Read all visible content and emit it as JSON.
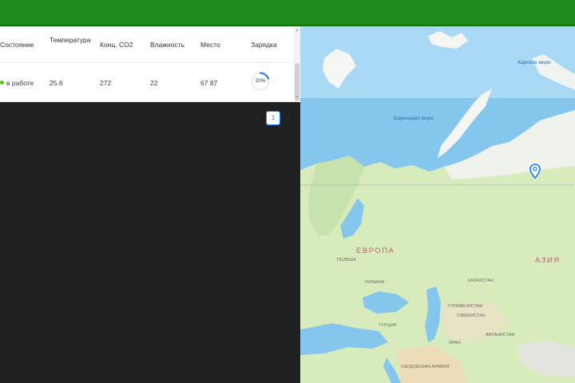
{
  "table": {
    "columns": [
      "Состояние",
      "Температура",
      "Конц. CO2",
      "Влажность",
      "Место",
      "Зарядка"
    ],
    "rows": [
      {
        "status": "в работе",
        "temperature": "25.6",
        "co2": "272",
        "humidity": "22",
        "place": "67 87",
        "charge_label": "20%",
        "charge_value": 0.2
      }
    ]
  },
  "pagination": {
    "current_page": "1"
  },
  "map": {
    "labels": {
      "kara_sea": "Карское море",
      "barents_sea": "Баренцево море",
      "europe": "ЕВРОПА",
      "asia": "АЗИЯ",
      "kazakhstan": "КАЗАХСТАН",
      "turkmenistan": "ТУРКМЕНИСТАН",
      "uzbekistan": "УЗБЕКИСТАН",
      "saudi_arabia": "САУДОВСКАЯ АРАВИЯ",
      "ukraine": "УКРАИНА",
      "poland": "ПОЛЬША",
      "iran": "ИРАН",
      "turkey": "ТУРЦИЯ",
      "afghanistan": "АФГАНИСТАН"
    }
  },
  "colors": {
    "topbar": "#1f8a1c",
    "status_ok": "#52c41a",
    "accent": "#1677ff",
    "sea": "#7cc0e8",
    "land": "#cfe5b0"
  }
}
